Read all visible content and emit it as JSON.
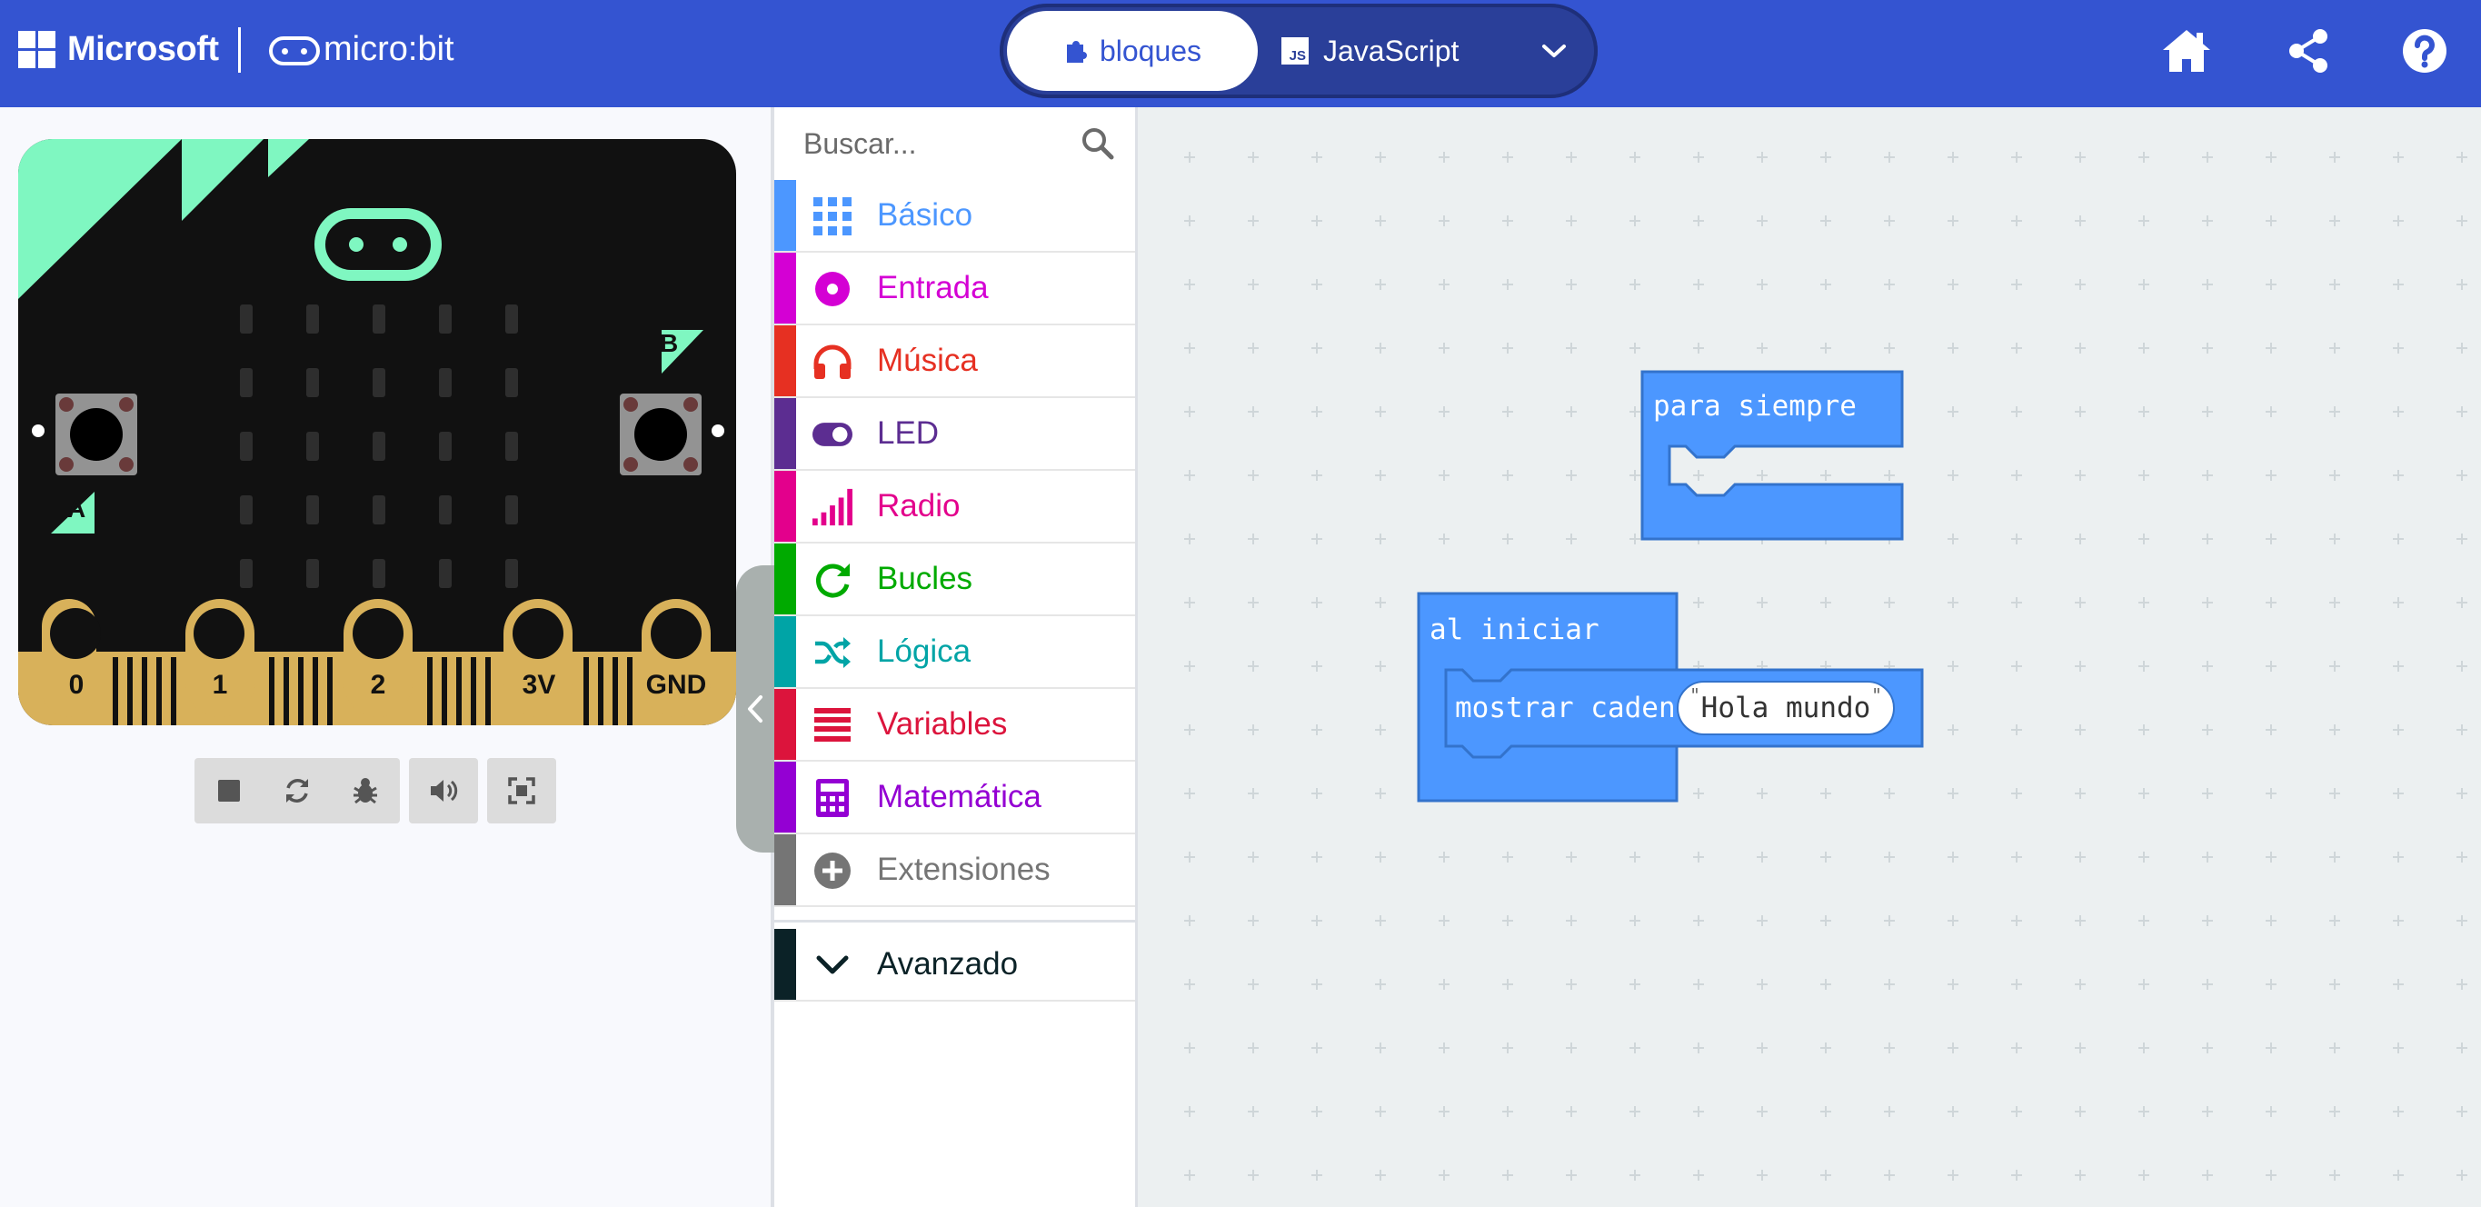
{
  "header": {
    "microsoft_label": "Microsoft",
    "microbit_label": "micro:bit",
    "tabs": {
      "blocks_label": "bloques",
      "javascript_label": "JavaScript",
      "js_badge": "JS"
    },
    "icons": [
      "home-icon",
      "share-icon",
      "help-icon"
    ],
    "colors": {
      "bar": "#3454d1",
      "toggle": "#2a3f99"
    }
  },
  "simulator": {
    "pins": [
      "0",
      "1",
      "2",
      "3V",
      "GND"
    ],
    "button_a": "A",
    "button_b": "B",
    "controls": [
      "stop-icon",
      "restart-icon",
      "debug-icon",
      "sound-icon",
      "fullscreen-icon"
    ]
  },
  "toolbox": {
    "search_placeholder": "Buscar...",
    "categories": [
      {
        "label": "Básico",
        "color": "#4c97ff",
        "icon": "grid-icon"
      },
      {
        "label": "Entrada",
        "color": "#d400d4",
        "icon": "input-icon"
      },
      {
        "label": "Música",
        "color": "#e63022",
        "icon": "headphones-icon"
      },
      {
        "label": "LED",
        "color": "#5c2d91",
        "icon": "toggle-icon"
      },
      {
        "label": "Radio",
        "color": "#e3008c",
        "icon": "signal-icon"
      },
      {
        "label": "Bucles",
        "color": "#00aa00",
        "icon": "loop-icon"
      },
      {
        "label": "Lógica",
        "color": "#00a4a6",
        "icon": "shuffle-icon"
      },
      {
        "label": "Variables",
        "color": "#dc143c",
        "icon": "list-icon"
      },
      {
        "label": "Matemática",
        "color": "#9400d3",
        "icon": "calculator-icon"
      },
      {
        "label": "Extensiones",
        "color": "#757575",
        "icon": "plus-circle-icon"
      }
    ],
    "advanced": {
      "label": "Avanzado",
      "color": "#0b2227",
      "icon": "chevron-down-icon"
    }
  },
  "workspace": {
    "forever_block": {
      "label": "para siempre"
    },
    "on_start_block": {
      "label": "al iniciar"
    },
    "show_string_block": {
      "label": "mostrar cadena",
      "value": "Hola mundo"
    },
    "colors": {
      "block": "#4c97ff",
      "block_border": "#3373cc",
      "background": "#ecf0f1"
    }
  }
}
